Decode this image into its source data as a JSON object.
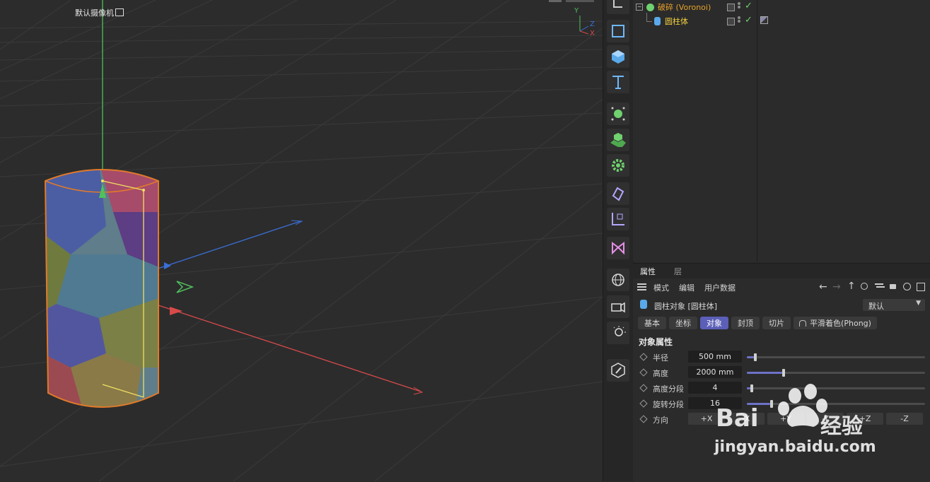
{
  "viewport": {
    "camera_label": "默认摄像机",
    "axis_labels": {
      "y": "Y",
      "z": "Z",
      "x": "X"
    }
  },
  "palette": {
    "tools": [
      "rectangle-spline-icon",
      "cube-icon",
      "text-icon",
      "cloner-icon",
      "voronoi-fracture-icon",
      "gear-effector-icon",
      "deformer-icon",
      "null-axis-icon",
      "field-icon",
      "sky-globe-icon",
      "camera-icon",
      "light-icon",
      "edit-pen-icon"
    ]
  },
  "object_manager": {
    "objects": [
      {
        "name": "破碎 (Voronoi)",
        "color": "#e6a129"
      },
      {
        "name": "圆柱体",
        "color": "#f0d040"
      }
    ]
  },
  "attributes": {
    "tabs": [
      "属性",
      "层"
    ],
    "menu": [
      "模式",
      "编辑",
      "用户数据"
    ],
    "object_title": "圆柱对象 [圆柱体]",
    "preset": "默认",
    "sub_tabs": [
      "基本",
      "坐标",
      "对象",
      "封顶",
      "切片",
      "平滑着色(Phong)"
    ],
    "active_sub_tab": "对象",
    "section_title": "对象属性",
    "properties": [
      {
        "label": "半径",
        "value": "500 mm",
        "fraction": 0.04
      },
      {
        "label": "高度",
        "value": "2000 mm",
        "fraction": 0.2
      },
      {
        "label": "高度分段",
        "value": "4",
        "fraction": 0.02
      },
      {
        "label": "旋转分段",
        "value": "16",
        "fraction": 0.13
      }
    ],
    "direction": {
      "label": "方向",
      "options": [
        "+X",
        "-X",
        "+Y",
        "-Y",
        "+Z",
        "-Z"
      ]
    },
    "accent_color": "#5b5fb7"
  },
  "watermark": {
    "brand": "Bai",
    "brand_cn": "经验",
    "url": "jingyan.baidu.com"
  }
}
